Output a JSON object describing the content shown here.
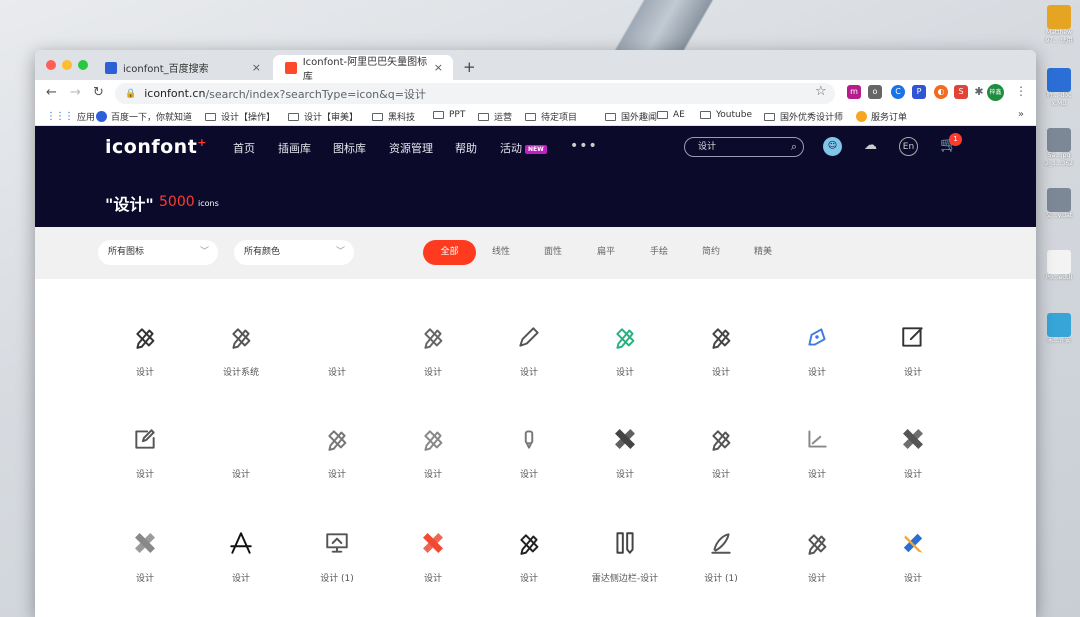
{
  "desktop": {
    "icons": [
      {
        "label": "Matthew",
        "sub": "97... 使用",
        "color": "#e5a523",
        "icon": "drive-icon"
      },
      {
        "label": "特...-doc",
        "sub": "x.MB",
        "color": "#2b6fd6",
        "icon": "word-doc-icon"
      },
      {
        "label": "5a...jpg",
        "sub": "2_3...362",
        "color": "#7d8896",
        "icon": "jpg-file-icon"
      },
      {
        "label": "交...y.dat",
        "sub": "",
        "color": "#7d8896",
        "icon": "tiff-file-icon"
      },
      {
        "label": "Po...edUI",
        "sub": "",
        "color": "#f3f3f3",
        "icon": "document-icon"
      },
      {
        "label": "未...许安",
        "sub": "",
        "color": "#37a5d8",
        "icon": "folder-icon"
      }
    ]
  },
  "browser": {
    "tabs": [
      {
        "title": "iconfont_百度搜索",
        "favicon_color": "#2e5fd8",
        "close": "×"
      },
      {
        "title": "Iconfont-阿里巴巴矢量图标库",
        "favicon_color": "#ff4a2a",
        "close": "×"
      }
    ],
    "new_tab": "+",
    "url_host": "iconfont.cn",
    "url_rest": "/search/index?searchType=icon&q=设计",
    "profile_label": "梓鑫",
    "bookmarks": [
      {
        "label": "应用",
        "type": "apps"
      },
      {
        "label": "百度一下，你就知道",
        "type": "baidu"
      },
      {
        "label": "设计【操作】",
        "type": "folder"
      },
      {
        "label": "设计【审美】",
        "type": "folder"
      },
      {
        "label": "黑科技",
        "type": "folder"
      },
      {
        "label": "PPT",
        "type": "folder"
      },
      {
        "label": "运营",
        "type": "folder"
      },
      {
        "label": "待定项目",
        "type": "folder"
      },
      {
        "label": "国外趣闻",
        "type": "folder"
      },
      {
        "label": "AE",
        "type": "folder"
      },
      {
        "label": "Youtube",
        "type": "folder"
      },
      {
        "label": "国外优秀设计师",
        "type": "folder"
      },
      {
        "label": "服务订单",
        "type": "orange"
      }
    ],
    "bookmarks_more": "»"
  },
  "site": {
    "logo": "iconfont",
    "logo_plus": "+",
    "nav": [
      "首页",
      "插画库",
      "图标库",
      "资源管理",
      "帮助",
      "活动"
    ],
    "new_badge": "NEW",
    "nav_more": "•••",
    "search_value": "设计",
    "lang_label": "En",
    "cart_count": "1",
    "result_query": "\"设计\"",
    "result_count": "5000",
    "result_unit": "icons",
    "accent": "#ff3b1f",
    "header_bg": "#0c0a2b"
  },
  "filters": {
    "icon_select": "所有图标",
    "color_select": "所有颜色",
    "styles": [
      "全部",
      "线性",
      "面性",
      "扁平",
      "手绘",
      "简约",
      "精美"
    ],
    "active_style": "全部"
  },
  "icons": [
    {
      "name": "设计",
      "glyph": "pencil-ruler-bold",
      "color": "#333333"
    },
    {
      "name": "设计系统",
      "glyph": "pencil-ruler-outline",
      "color": "#555555"
    },
    {
      "name": "设计",
      "glyph": "blank",
      "color": "#cccccc"
    },
    {
      "name": "设计",
      "glyph": "pencil-ruler-outline",
      "color": "#666666"
    },
    {
      "name": "设计",
      "glyph": "pencil",
      "color": "#555555"
    },
    {
      "name": "设计",
      "glyph": "pencil-ruler-outline",
      "color": "#2bb07f"
    },
    {
      "name": "设计",
      "glyph": "pencil-ruler-outline",
      "color": "#444444"
    },
    {
      "name": "设计",
      "glyph": "pen-tag",
      "color": "#3b7de0"
    },
    {
      "name": "设计",
      "glyph": "edit-square",
      "color": "#333333"
    },
    {
      "name": "设计",
      "glyph": "edit-doc",
      "color": "#555555"
    },
    {
      "name": "设计",
      "glyph": "blank",
      "color": "#cccccc"
    },
    {
      "name": "设计",
      "glyph": "pencil-ruler-outline",
      "color": "#777777"
    },
    {
      "name": "设计",
      "glyph": "pencil-ruler-outline",
      "color": "#888888"
    },
    {
      "name": "设计",
      "glyph": "small-pen",
      "color": "#777777"
    },
    {
      "name": "设计",
      "glyph": "ruler-cross",
      "color": "#444444"
    },
    {
      "name": "设计",
      "glyph": "pencil-ruler-bold",
      "color": "#555555"
    },
    {
      "name": "设计",
      "glyph": "angle-chart",
      "color": "#888888"
    },
    {
      "name": "设计",
      "glyph": "ruler-cross",
      "color": "#555555"
    },
    {
      "name": "设计",
      "glyph": "ruler-cross",
      "color": "#888888"
    },
    {
      "name": "设计",
      "glyph": "compass-a",
      "color": "#111111"
    },
    {
      "name": "设计 (1)",
      "glyph": "monitor-pen",
      "color": "#555555"
    },
    {
      "name": "设计",
      "glyph": "ruler-cross",
      "color": "#f04a35"
    },
    {
      "name": "设计",
      "glyph": "pencil-ruler-bold",
      "color": "#222222"
    },
    {
      "name": "雷达侧边栏-设计",
      "glyph": "pencil-ruler-pair",
      "color": "#444444"
    },
    {
      "name": "设计 (1)",
      "glyph": "pen-nib",
      "color": "#555555"
    },
    {
      "name": "设计",
      "glyph": "pencil-ruler-outline",
      "color": "#555555"
    },
    {
      "name": "设计",
      "glyph": "pencil-ruler-blue",
      "color": "#2a6fd6"
    }
  ]
}
